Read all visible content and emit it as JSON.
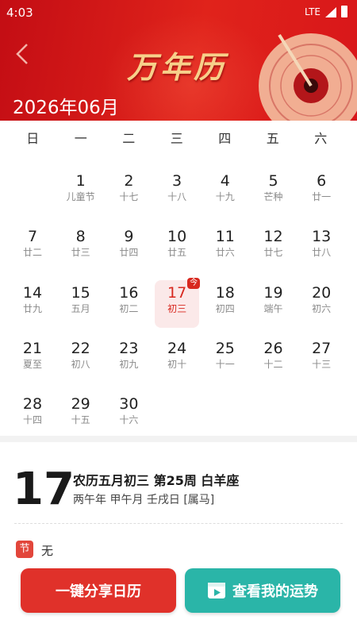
{
  "status_bar": {
    "time": "4:03",
    "network": "LTE"
  },
  "header": {
    "banner_title": "万年历",
    "month_title": "2026年06月"
  },
  "weekdays": [
    "日",
    "一",
    "二",
    "三",
    "四",
    "五",
    "六"
  ],
  "calendar": {
    "today": "17",
    "today_badge": "今",
    "days": [
      {
        "d": "1",
        "l": "儿童节"
      },
      {
        "d": "2",
        "l": "十七"
      },
      {
        "d": "3",
        "l": "十八"
      },
      {
        "d": "4",
        "l": "十九"
      },
      {
        "d": "5",
        "l": "芒种"
      },
      {
        "d": "6",
        "l": "廿一"
      },
      {
        "d": "7",
        "l": "廿二"
      },
      {
        "d": "8",
        "l": "廿三"
      },
      {
        "d": "9",
        "l": "廿四"
      },
      {
        "d": "10",
        "l": "廿五"
      },
      {
        "d": "11",
        "l": "廿六"
      },
      {
        "d": "12",
        "l": "廿七"
      },
      {
        "d": "13",
        "l": "廿八"
      },
      {
        "d": "14",
        "l": "廿九"
      },
      {
        "d": "15",
        "l": "五月"
      },
      {
        "d": "16",
        "l": "初二"
      },
      {
        "d": "17",
        "l": "初三"
      },
      {
        "d": "18",
        "l": "初四"
      },
      {
        "d": "19",
        "l": "端午"
      },
      {
        "d": "20",
        "l": "初六"
      },
      {
        "d": "21",
        "l": "夏至"
      },
      {
        "d": "22",
        "l": "初八"
      },
      {
        "d": "23",
        "l": "初九"
      },
      {
        "d": "24",
        "l": "初十"
      },
      {
        "d": "25",
        "l": "十一"
      },
      {
        "d": "26",
        "l": "十二"
      },
      {
        "d": "27",
        "l": "十三"
      },
      {
        "d": "28",
        "l": "十四"
      },
      {
        "d": "29",
        "l": "十五"
      },
      {
        "d": "30",
        "l": "十六"
      }
    ]
  },
  "detail": {
    "day": "17",
    "line1": "农历五月初三 第25周 白羊座",
    "line2": "两午年 甲午月 壬戌日 [属马]",
    "festival_icon": "节",
    "festival_value": "无"
  },
  "buttons": {
    "share": "一键分享日历",
    "fortune": "查看我的运势"
  },
  "colors": {
    "brand_red": "#e0231b",
    "teal": "#2ab5a8",
    "today_bg": "#fbe9e9"
  }
}
